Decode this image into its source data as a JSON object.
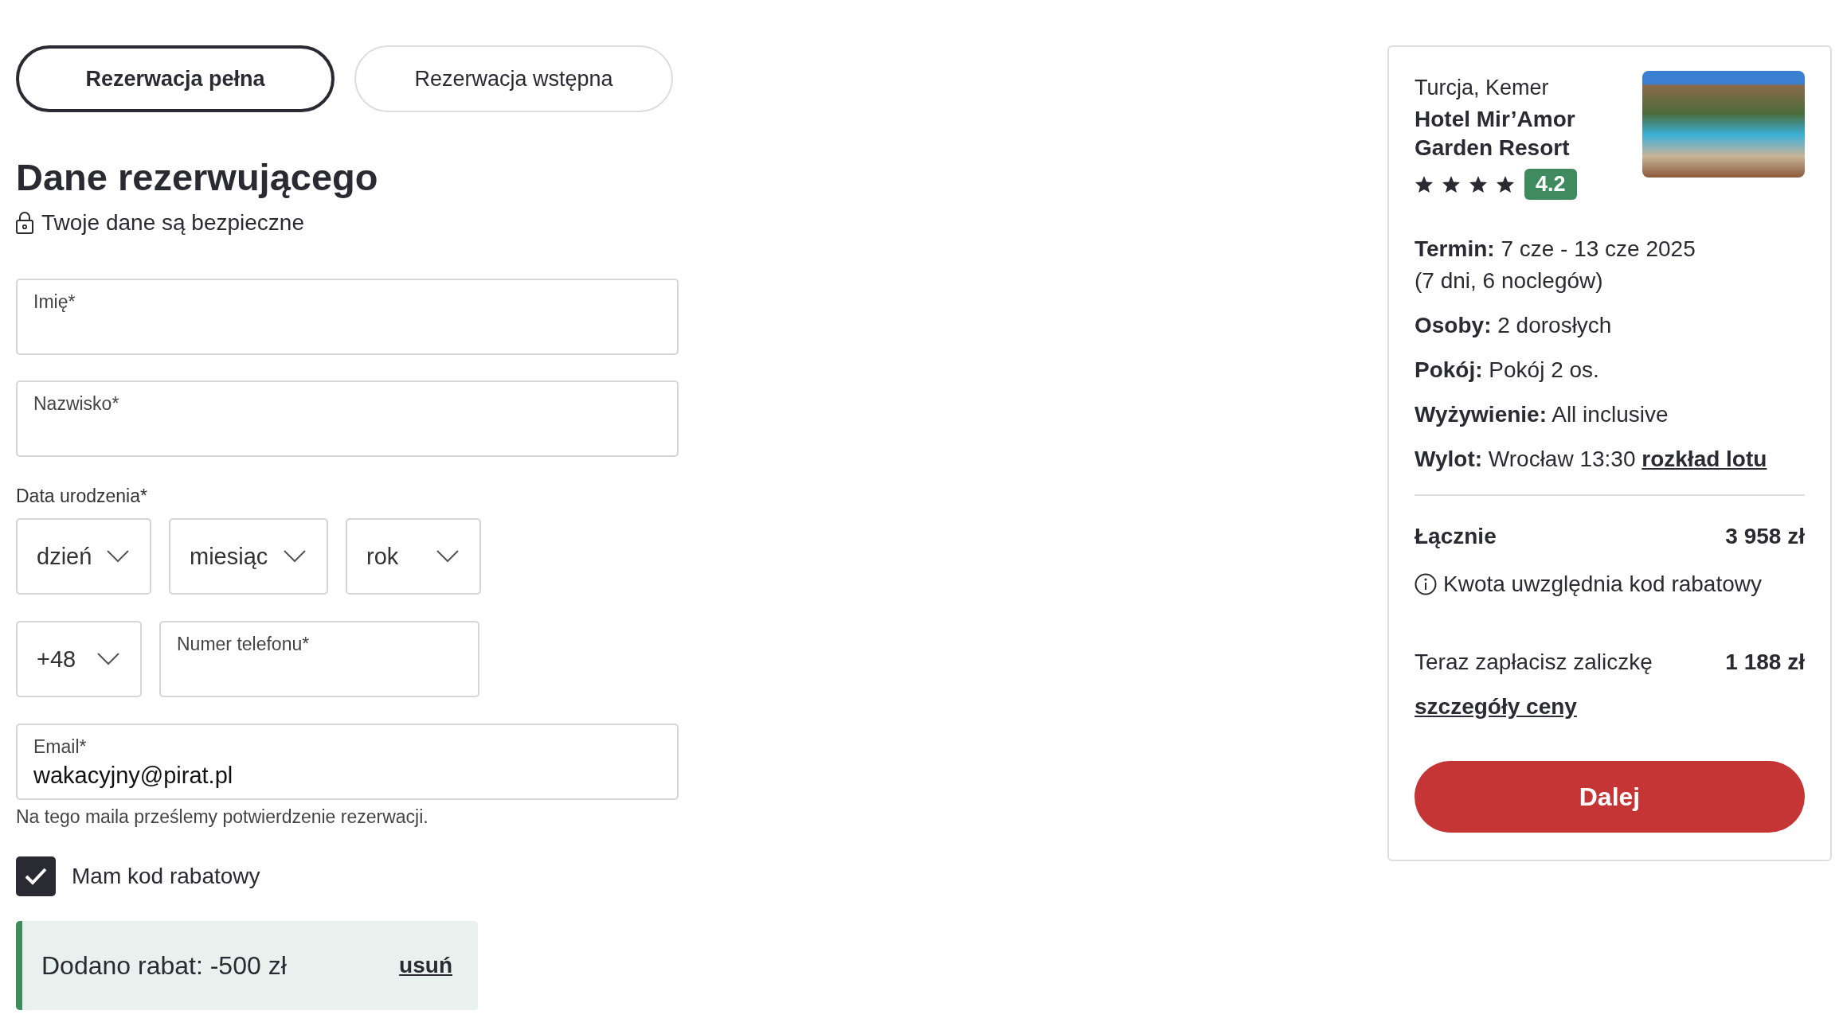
{
  "tabs": [
    {
      "label": "Rezerwacja pełna",
      "selected": true
    },
    {
      "label": "Rezerwacja wstępna",
      "selected": false
    }
  ],
  "heading": "Dane rezerwującego",
  "secure_note": "Twoje dane są bezpieczne",
  "name_fields": [
    {
      "label": "Imię*"
    },
    {
      "label": "Nazwisko*"
    }
  ],
  "birth_date": {
    "label": "Data urodzenia*",
    "selects": [
      {
        "placeholder": "dzień"
      },
      {
        "placeholder": "miesiąc"
      },
      {
        "placeholder": "rok"
      }
    ]
  },
  "phone": {
    "prefix": "+48",
    "label": "Numer telefonu*"
  },
  "email": {
    "label": "Email*",
    "value": "wakacyjny@pirat.pl",
    "hint": "Na tego maila prześlemy potwierdzenie rezerwacji."
  },
  "discount_checkbox": {
    "label": "Mam kod rabatowy",
    "checked": true
  },
  "discount_notice": {
    "text": "Dodano rabat: -500 zł",
    "link": "usuń"
  },
  "summary": {
    "location": "Turcja, Kemer",
    "hotel": "Hotel Mir’Amor Garden Resort",
    "stars": 4,
    "rating": "4.2",
    "details": [
      {
        "label": "Termin:",
        "value": "7 cze - 13 cze 2025",
        "note": "(7 dni, 6 noclegów)"
      },
      {
        "label": "Osoby:",
        "value": "2 dorosłych"
      },
      {
        "label": "Pokój:",
        "value": "Pokój 2 os."
      },
      {
        "label": "Wyżywienie:",
        "value": "All inclusive"
      },
      {
        "label": "Wylot:",
        "value": "Wrocław 13:30",
        "link": "rozkład lotu"
      }
    ],
    "total_label": "Łącznie",
    "total_value": "3 958 zł",
    "total_note": "Kwota uwzględnia kod rabatowy",
    "deposit_label": "Teraz zapłacisz zaliczkę",
    "deposit_value": "1 188 zł",
    "details_link": "szczegóły ceny",
    "button": "Dalej"
  }
}
